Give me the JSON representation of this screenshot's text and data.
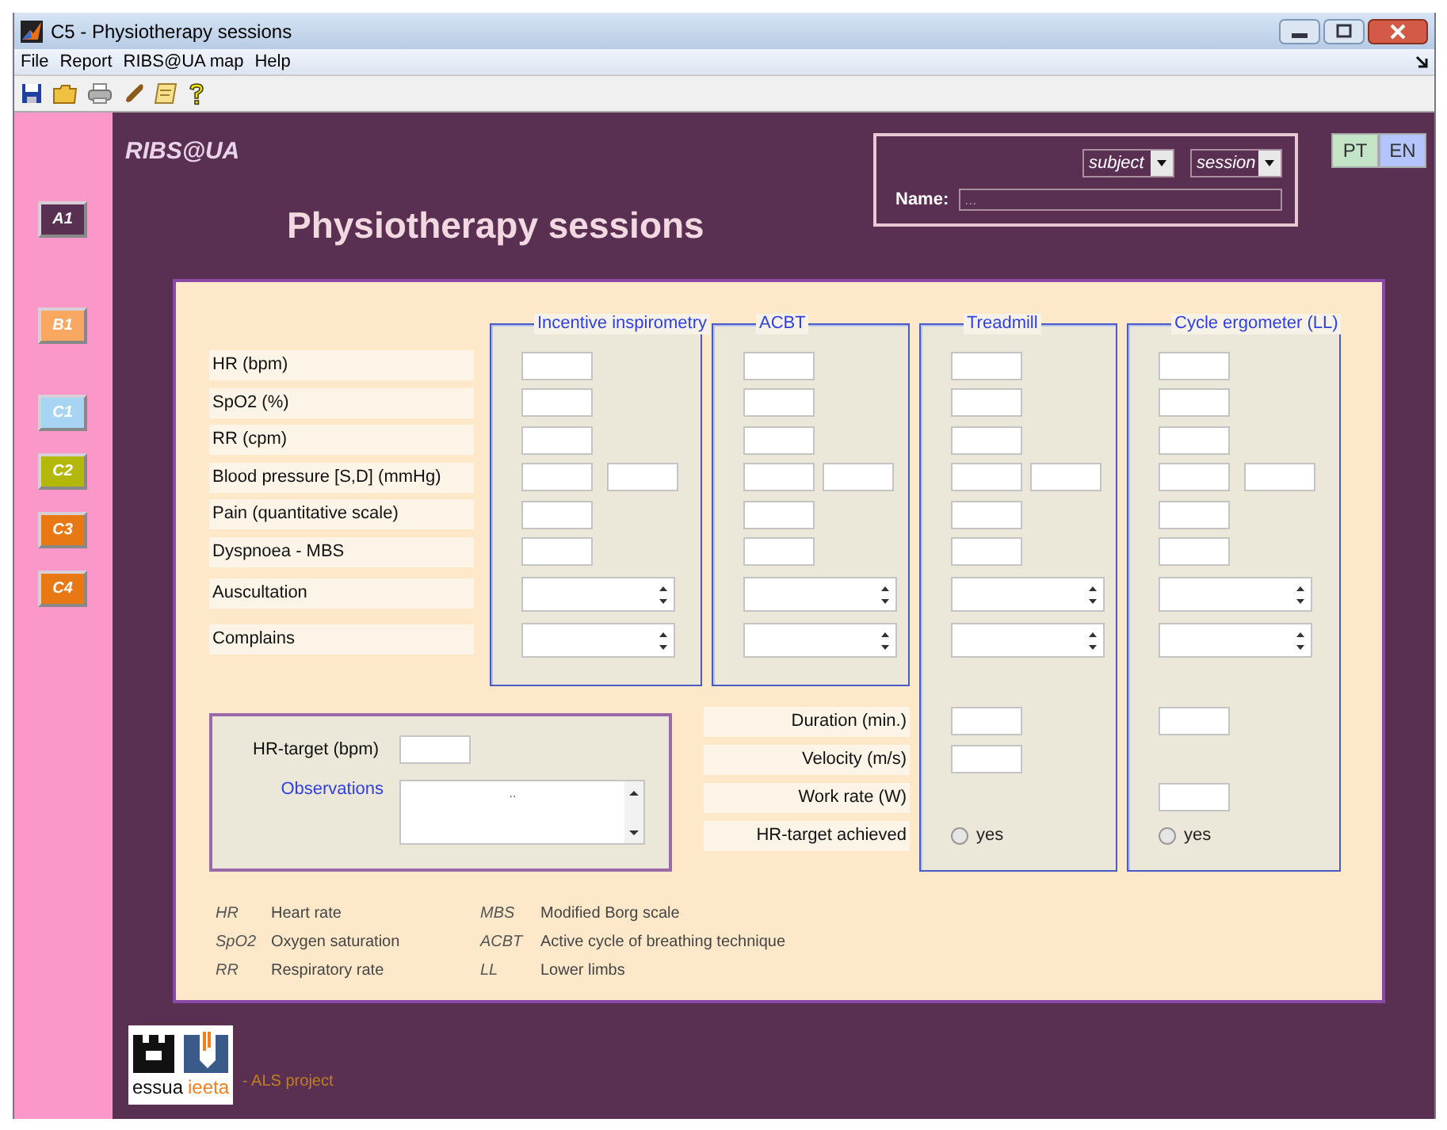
{
  "window": {
    "title": "C5 - Physiotherapy sessions"
  },
  "menu": [
    "File",
    "Report",
    "RIBS@UA map",
    "Help"
  ],
  "sidebar": [
    {
      "label": "A1",
      "color": "#5a3052"
    },
    {
      "label": "B1",
      "color": "#f9a862"
    },
    {
      "label": "C1",
      "color": "#a8d4f4"
    },
    {
      "label": "C2",
      "color": "#b4b80a"
    },
    {
      "label": "C3",
      "color": "#e87814"
    },
    {
      "label": "C4",
      "color": "#e87814"
    }
  ],
  "brand": "RIBS@UA",
  "heading": "Physiotherapy sessions",
  "selector": {
    "dropdowns": [
      "subject",
      "session"
    ],
    "name_label": "Name:",
    "name_value": "..."
  },
  "languages": [
    {
      "label": "PT",
      "color": "#c4e4c8"
    },
    {
      "label": "EN",
      "color": "#b4c4fc"
    }
  ],
  "measures": [
    {
      "label": "HR (bpm)",
      "kind": "single"
    },
    {
      "label": "SpO2 (%)",
      "kind": "single"
    },
    {
      "label": "RR (cpm)",
      "kind": "single"
    },
    {
      "label": "Blood pressure [S,D] (mmHg)",
      "kind": "pair"
    },
    {
      "label": "Pain (quantitative scale)",
      "kind": "single"
    },
    {
      "label": "Dyspnoea - MBS",
      "kind": "single"
    },
    {
      "label": "Auscultation",
      "kind": "spinner"
    },
    {
      "label": "Complains",
      "kind": "spinner"
    }
  ],
  "exercises": [
    {
      "title": "Incentive inspirometry"
    },
    {
      "title": "ACBT"
    },
    {
      "title": "Treadmill",
      "extras": [
        {
          "kind": "input"
        },
        {
          "kind": "input"
        },
        {
          "kind": "none"
        },
        {
          "kind": "radio",
          "label": "yes",
          "selected": false
        }
      ]
    },
    {
      "title": "Cycle ergometer (LL)",
      "extras": [
        {
          "kind": "input"
        },
        {
          "kind": "none"
        },
        {
          "kind": "input"
        },
        {
          "kind": "radio",
          "label": "yes",
          "selected": false
        }
      ]
    }
  ],
  "target": {
    "label": "HR-target (bpm)",
    "observations_label": "Observations",
    "observations_value": ".."
  },
  "extra_measures": [
    "Duration (min.)",
    "Velocity (m/s)",
    "Work rate (W)",
    "HR-target achieved"
  ],
  "abbreviations": [
    {
      "abbr": "HR",
      "meaning": "Heart rate"
    },
    {
      "abbr": "MBS",
      "meaning": "Modified Borg scale"
    },
    {
      "abbr": "SpO2",
      "meaning": "Oxygen saturation"
    },
    {
      "abbr": "ACBT",
      "meaning": "Active cycle of breathing technique"
    },
    {
      "abbr": "RR",
      "meaning": "Respiratory rate"
    },
    {
      "abbr": "LL",
      "meaning": "Lower limbs"
    }
  ],
  "footer": {
    "logo": [
      "essua",
      "ieeta"
    ],
    "caption": "- ALS project"
  }
}
